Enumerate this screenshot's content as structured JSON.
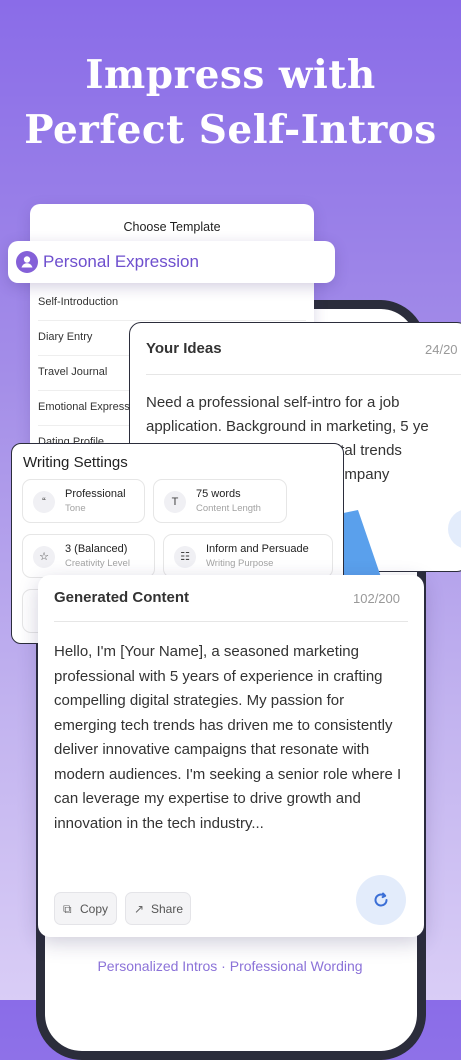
{
  "headline": {
    "line1": "Impress with",
    "line2": "Perfect Self-Intros"
  },
  "template_card": {
    "title": "Choose Template",
    "selected": "Personal Expression",
    "items": [
      "Self-Introduction",
      "Diary Entry",
      "Travel Journal",
      "Emotional Express",
      "Dating Profile"
    ]
  },
  "ideas_card": {
    "title": "Your Ideas",
    "count": "24/20",
    "text": "Need a professional self-intro for a job\napplication. Background in marketing, 5 ye\n                                   out digital trends\n                                 a tech company"
  },
  "writing_settings": {
    "title": "Writing Settings",
    "chips": [
      {
        "icon": "quote-icon",
        "glyph": "“",
        "value": "Professional",
        "label": "Tone"
      },
      {
        "icon": "text-icon",
        "glyph": "T",
        "value": "75 words",
        "label": "Content Length"
      },
      {
        "icon": "lightbulb-icon",
        "glyph": "☆",
        "value": "3 (Balanced)",
        "label": "Creativity Level"
      },
      {
        "icon": "hierarchy-icon",
        "glyph": "☷",
        "value": "Inform and Persuade",
        "label": "Writing Purpose"
      }
    ]
  },
  "generated": {
    "title": "Generated Content",
    "count": "102/200",
    "text": "Hello, I'm [Your Name], a seasoned marketing professional with 5 years of experience in crafting compelling digital strategies. My passion for emerging tech trends has driven me to consistently deliver innovative campaigns that resonate with modern audiences. I'm seeking a senior role where I can leverage my expertise to drive growth and innovation in the tech industry...",
    "copy_label": "Copy",
    "share_label": "Share"
  },
  "footer": "Personalized Intros · Professional Wording",
  "colors": {
    "accent": "#6e4fce",
    "background_top": "#8a6ce8",
    "refresh": "#3b6fd6"
  }
}
